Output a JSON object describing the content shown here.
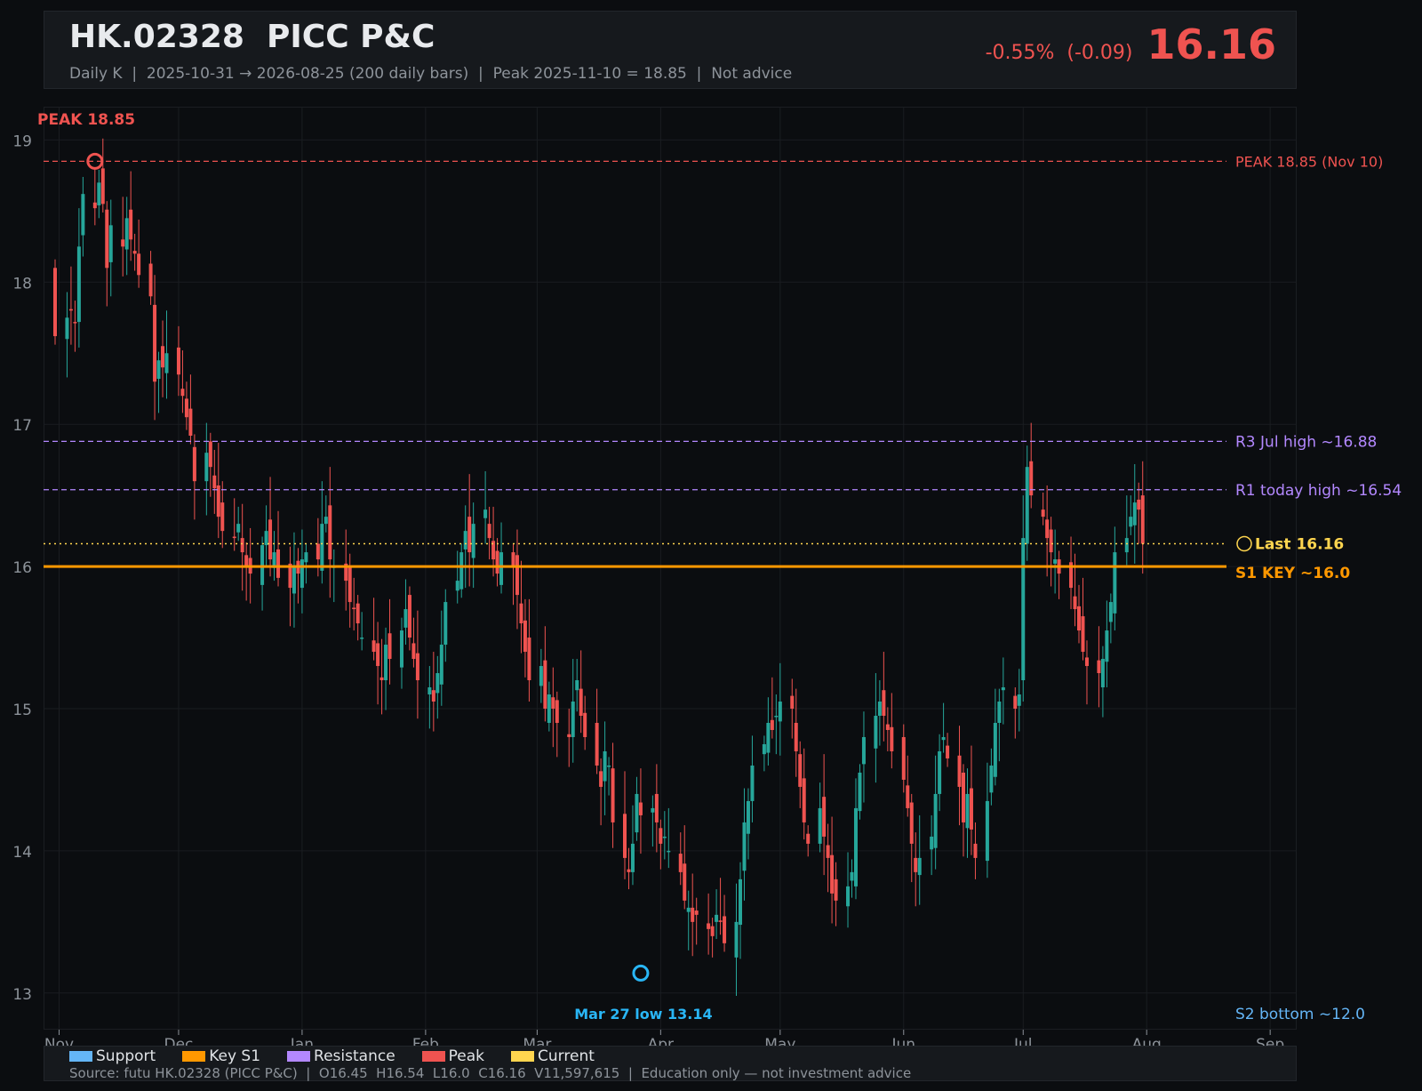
{
  "header": {
    "title": "HK.02328  PICC P&C",
    "subtitle": "Daily K  |  2025-10-31 → 2026-08-25 (200 daily bars)  |  Peak 2025-11-10 = 18.85  |  Not advice",
    "change": "-0.55%  (-0.09)",
    "price": "16.16"
  },
  "colors": {
    "up": "#26a69a",
    "down": "#ef5350",
    "support": "#64b5f6",
    "key_s1": "#ff9800",
    "resistance": "#b388ff",
    "peak": "#ef5350",
    "current": "#ffd54f",
    "low_marker": "#29b6f6"
  },
  "chart_data": {
    "type": "candlestick",
    "ylim": [
      12.75,
      19.25
    ],
    "yticks": [
      "13",
      "14",
      "15",
      "16",
      "17",
      "18",
      "19"
    ],
    "x_start": "2025-10-31",
    "x_end": "2026-08-25",
    "month_ticks": [
      {
        "label": "Nov",
        "date": "2025-11-01"
      },
      {
        "label": "Dec",
        "date": "2025-12-01"
      },
      {
        "label": "Jan",
        "date": "2026-01-01"
      },
      {
        "label": "Feb",
        "date": "2026-02-01"
      },
      {
        "label": "Mar",
        "date": "2026-03-01"
      },
      {
        "label": "Apr",
        "date": "2026-04-01"
      },
      {
        "label": "May",
        "date": "2026-05-01"
      },
      {
        "label": "Jun",
        "date": "2026-06-01"
      },
      {
        "label": "Jul",
        "date": "2026-07-01"
      },
      {
        "label": "Aug",
        "date": "2026-08-01"
      },
      {
        "label": "Sep",
        "date": "2026-09-01"
      }
    ],
    "closes": [
      17.62,
      17.75,
      17.8,
      17.72,
      18.25,
      18.62,
      18.52,
      18.7,
      18.55,
      18.1,
      18.4,
      18.25,
      18.45,
      18.3,
      18.2,
      18.05,
      17.9,
      17.3,
      17.45,
      17.4,
      17.5,
      17.35,
      17.2,
      17.05,
      16.92,
      16.6,
      16.8,
      16.7,
      16.55,
      16.35,
      16.25,
      16.2,
      16.3,
      16.1,
      16.0,
      15.95,
      16.15,
      16.25,
      16.05,
      16.1,
      15.92,
      15.85,
      16.0,
      15.95,
      16.05,
      16.1,
      16.05,
      16.3,
      16.35,
      16.05,
      16.0,
      15.9,
      15.75,
      15.7,
      15.6,
      15.5,
      15.4,
      15.3,
      15.2,
      15.45,
      15.35,
      15.55,
      15.7,
      15.5,
      15.35,
      15.2,
      15.15,
      15.05,
      15.25,
      15.45,
      15.75,
      15.9,
      16.1,
      16.25,
      16.1,
      16.3,
      16.4,
      16.2,
      16.05,
      15.95,
      16.1,
      16.0,
      15.8,
      15.6,
      15.4,
      15.2,
      15.3,
      15.0,
      15.1,
      15.0,
      14.9,
      14.8,
      15.05,
      15.2,
      14.95,
      14.8,
      14.6,
      14.45,
      14.7,
      14.6,
      14.2,
      13.95,
      13.85,
      14.05,
      14.4,
      14.25,
      14.3,
      14.2,
      14.05,
      14.1,
      14.0,
      13.85,
      13.65,
      13.6,
      13.5,
      13.55,
      13.45,
      13.4,
      13.55,
      13.5,
      13.35,
      13.5,
      13.8,
      14.2,
      14.35,
      14.6,
      14.75,
      14.9,
      14.85,
      14.95,
      15.05,
      15.0,
      14.7,
      14.45,
      14.2,
      14.05,
      14.3,
      14.1,
      13.95,
      13.7,
      13.65,
      13.75,
      13.85,
      14.3,
      14.55,
      14.8,
      14.95,
      15.05,
      14.95,
      14.85,
      14.7,
      14.5,
      14.3,
      14.05,
      13.85,
      13.95,
      14.1,
      14.4,
      14.7,
      14.8,
      14.65,
      14.45,
      14.2,
      14.4,
      14.15,
      13.95,
      14.35,
      14.6,
      14.9,
      15.05,
      15.15,
      15.0,
      15.1,
      16.2,
      16.7,
      16.5,
      16.35,
      16.2,
      16.1,
      16.05,
      15.95,
      15.85,
      15.7,
      15.55,
      15.4,
      15.3,
      15.25,
      15.35,
      15.55,
      15.75,
      16.1,
      16.2,
      16.35,
      16.45,
      16.4,
      16.16
    ],
    "levels": [
      {
        "name": "peak",
        "value": 18.85,
        "label": "PEAK 18.85 (Nov 10)",
        "style": "dashed"
      },
      {
        "name": "r3",
        "value": 16.88,
        "label": "R3 Jul high ~16.88",
        "style": "dashed"
      },
      {
        "name": "r1",
        "value": 16.54,
        "label": "R1 today high ~16.54",
        "style": "dashed"
      },
      {
        "name": "last",
        "value": 16.16,
        "label": "Last 16.16",
        "style": "dotted"
      },
      {
        "name": "s1",
        "value": 16.0,
        "label": "S1 KEY ~16.0",
        "style": "solid"
      },
      {
        "name": "s2",
        "value": 12.0,
        "label": "S2 bottom ~12.0",
        "style": "offscale"
      }
    ],
    "annotations": [
      {
        "name": "peak",
        "label": "PEAK 18.85",
        "date": "2025-11-10",
        "value": 18.85
      },
      {
        "name": "low",
        "label": "Mar 27 low 13.14",
        "date": "2026-03-27",
        "value": 13.14
      }
    ]
  },
  "legend": [
    {
      "label": "Support",
      "color": "#64b5f6"
    },
    {
      "label": "Key S1",
      "color": "#ff9800"
    },
    {
      "label": "Resistance",
      "color": "#b388ff"
    },
    {
      "label": "Peak",
      "color": "#ef5350"
    },
    {
      "label": "Current",
      "color": "#ffd54f"
    }
  ],
  "footer": {
    "source": "Source: futu HK.02328 (PICC P&C)  |  O16.45  H16.54  L16.0  C16.16  V11,597,615  |  Education only — not investment advice"
  }
}
